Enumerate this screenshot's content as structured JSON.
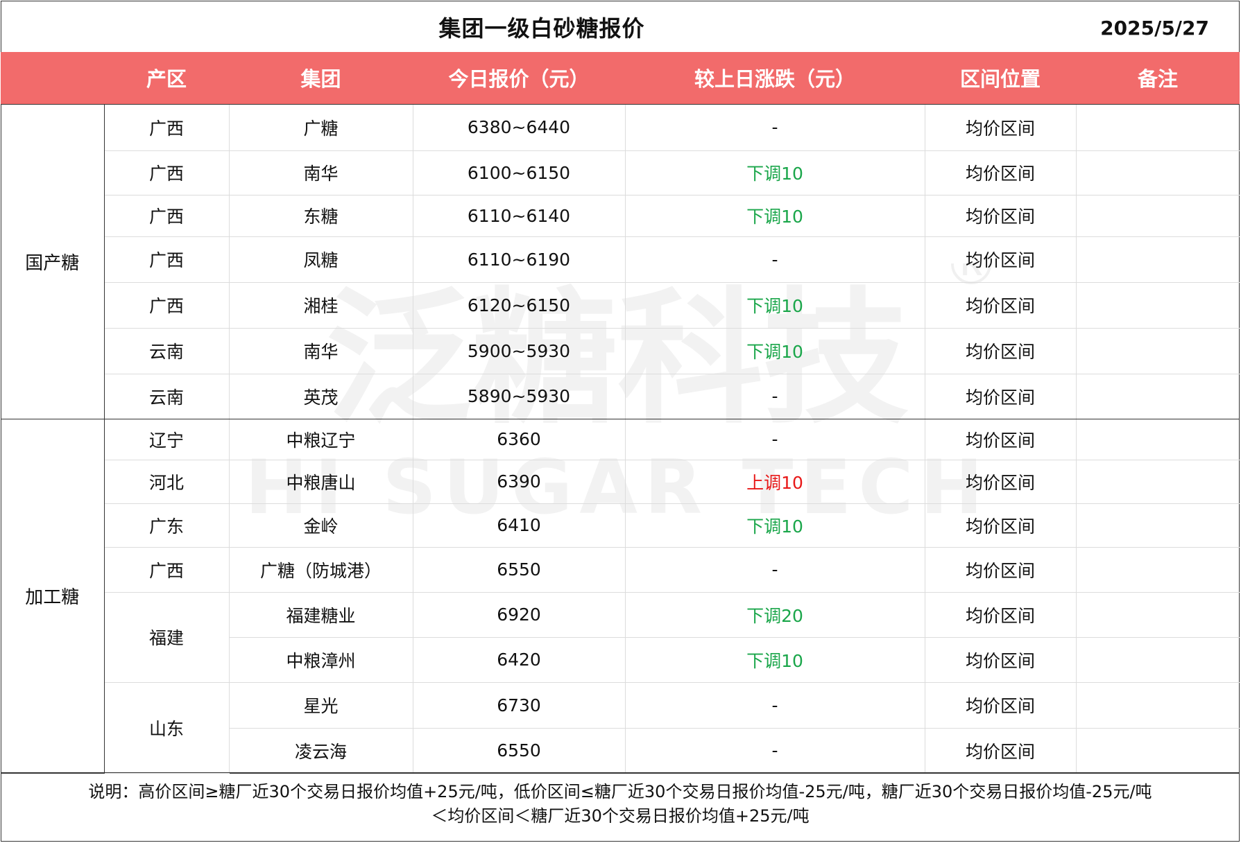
{
  "title": "集团一级白砂糖报价",
  "date": "2025/5/27",
  "colors": {
    "header_bg": "#f26b6b",
    "down": "#1aa64a",
    "up": "#e81818"
  },
  "headers": [
    "产区",
    "集团",
    "今日报价（元）",
    "较上日涨跌（元）",
    "区间位置",
    "备注"
  ],
  "categories": [
    "国产糖",
    "加工糖"
  ],
  "rows_domestic": [
    {
      "region": "广西",
      "group": "广糖",
      "price": "6380~6440",
      "change": "-",
      "trend": "flat",
      "position": "均价区间",
      "note": ""
    },
    {
      "region": "广西",
      "group": "南华",
      "price": "6100~6150",
      "change": "下调10",
      "trend": "down",
      "position": "均价区间",
      "note": ""
    },
    {
      "region": "广西",
      "group": "东糖",
      "price": "6110~6140",
      "change": "下调10",
      "trend": "down",
      "position": "均价区间",
      "note": ""
    },
    {
      "region": "广西",
      "group": "凤糖",
      "price": "6110~6190",
      "change": "-",
      "trend": "flat",
      "position": "均价区间",
      "note": ""
    },
    {
      "region": "广西",
      "group": "湘桂",
      "price": "6120~6150",
      "change": "下调10",
      "trend": "down",
      "position": "均价区间",
      "note": ""
    },
    {
      "region": "云南",
      "group": "南华",
      "price": "5900~5930",
      "change": "下调10",
      "trend": "down",
      "position": "均价区间",
      "note": ""
    },
    {
      "region": "云南",
      "group": "英茂",
      "price": "5890~5930",
      "change": "-",
      "trend": "flat",
      "position": "均价区间",
      "note": ""
    }
  ],
  "rows_processed": [
    {
      "region": "辽宁",
      "group": "中粮辽宁",
      "price": "6360",
      "change": "-",
      "trend": "flat",
      "position": "均价区间",
      "note": ""
    },
    {
      "region": "河北",
      "group": "中粮唐山",
      "price": "6390",
      "change": "上调10",
      "trend": "up",
      "position": "均价区间",
      "note": ""
    },
    {
      "region": "广东",
      "group": "金岭",
      "price": "6410",
      "change": "下调10",
      "trend": "down",
      "position": "均价区间",
      "note": ""
    },
    {
      "region": "广西",
      "group": "广糖（防城港）",
      "price": "6550",
      "change": "-",
      "trend": "flat",
      "position": "均价区间",
      "note": ""
    },
    {
      "region": "福建",
      "group": "福建糖业",
      "price": "6920",
      "change": "下调20",
      "trend": "down",
      "position": "均价区间",
      "note": ""
    },
    {
      "region": "",
      "group": "中粮漳州",
      "price": "6420",
      "change": "下调10",
      "trend": "down",
      "position": "均价区间",
      "note": ""
    },
    {
      "region": "山东",
      "group": "星光",
      "price": "6730",
      "change": "-",
      "trend": "flat",
      "position": "均价区间",
      "note": ""
    },
    {
      "region": "",
      "group": "凌云海",
      "price": "6550",
      "change": "-",
      "trend": "flat",
      "position": "均价区间",
      "note": ""
    }
  ],
  "note_line1": "说明：高价区间≥糖厂近30个交易日报价均值+25元/吨，低价区间≤糖厂近30个交易日报价均值-25元/吨，糖厂近30个交易日报价均值-25元/吨",
  "note_line2": "＜均价区间＜糖厂近30个交易日报价均值+25元/吨",
  "watermark": {
    "cn": "泛糖科技",
    "en": "HI SUGAR TECH",
    "mark": "®"
  }
}
